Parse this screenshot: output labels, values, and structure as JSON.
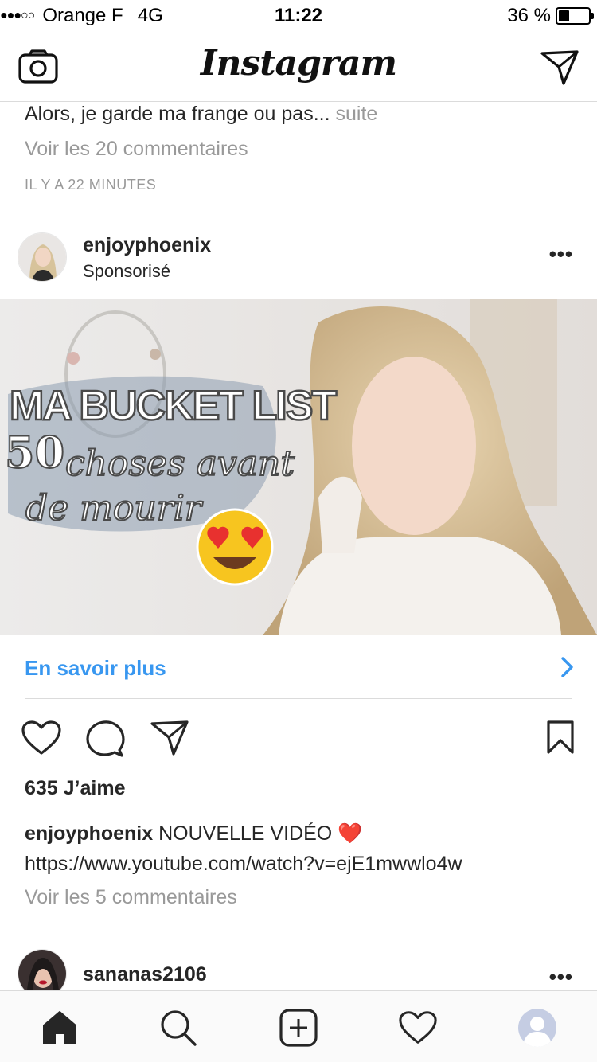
{
  "status_bar": {
    "signal": "●●●○○",
    "carrier": "Orange F",
    "network": "4G",
    "time": "11:22",
    "battery_percent_label": "36 %",
    "battery_level": 0.36
  },
  "nav": {
    "title": "Instagram"
  },
  "previous_post": {
    "caption": "Alors, je garde ma frange ou pas...",
    "more_label": "suite",
    "view_comments": "Voir les 20 commentaires",
    "time_ago": "IL Y A 22 MINUTES"
  },
  "post": {
    "username": "enjoyphoenix",
    "sponsored_label": "Sponsorisé",
    "image_text": {
      "line1": "MA BUCKET LIST",
      "line2_num": "50",
      "line2": "choses avant",
      "line3": "de mourir",
      "emoji": "😍"
    },
    "cta_label": "En savoir plus",
    "likes": "635 J’aime",
    "caption_user": "enjoyphoenix",
    "caption_text": "NOUVELLE VIDÉO ❤️",
    "caption_link": "https://www.youtube.com/watch?v=ejE1mwwlo4w",
    "view_comments": "Voir les 5 commentaires"
  },
  "next_post": {
    "username": "sananas2106"
  },
  "colors": {
    "link_blue": "#3897f0",
    "muted_gray": "#999999",
    "text": "#262626",
    "divider": "#dbdbdb"
  },
  "icons": {
    "nav": [
      "camera-icon",
      "direct-message-icon"
    ],
    "actions": [
      "heart-icon",
      "comment-icon",
      "share-icon",
      "bookmark-icon"
    ],
    "tabs": [
      "home-icon",
      "search-icon",
      "add-post-icon",
      "activity-heart-icon",
      "profile-icon"
    ]
  }
}
